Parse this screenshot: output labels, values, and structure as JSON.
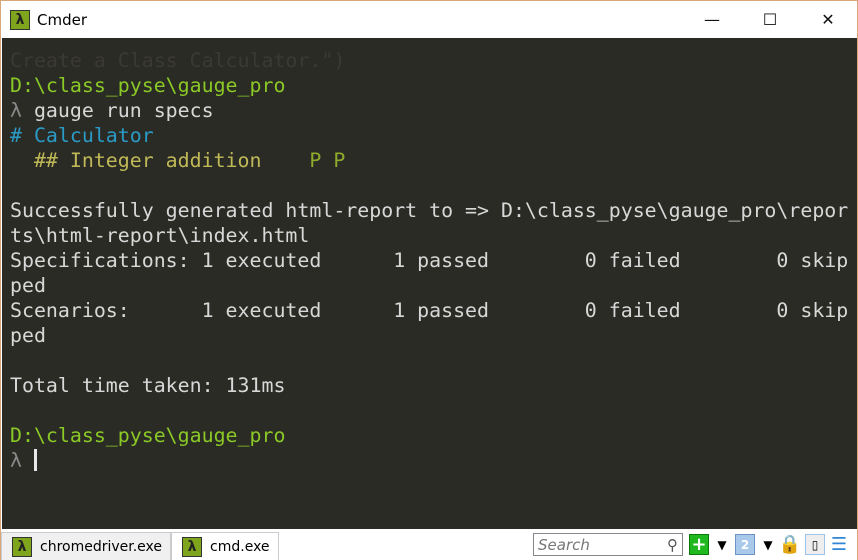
{
  "window": {
    "title": "Cmder",
    "minimize": "—",
    "maximize": "☐",
    "close": "✕"
  },
  "terminal": {
    "lines": [
      [
        {
          "t": "Create a Class Calculator.\")",
          "k": "f"
        }
      ],
      [
        {
          "t": "D:\\class_pyse\\gauge_pro",
          "k": "g"
        }
      ],
      [
        {
          "t": "λ ",
          "k": "l"
        },
        {
          "t": "gauge run specs",
          "k": ""
        }
      ],
      [
        {
          "t": "# Calculator",
          "k": "c"
        }
      ],
      [
        {
          "t": "  ## Integer addition    ",
          "k": "y"
        },
        {
          "t": "P P",
          "k": "p"
        }
      ],
      [
        {
          "t": "",
          "k": ""
        }
      ],
      [
        {
          "t": "Successfully generated html-report to => D:\\class_pyse\\gauge_pro\\repor",
          "k": ""
        }
      ],
      [
        {
          "t": "ts\\html-report\\index.html",
          "k": ""
        }
      ],
      [
        {
          "t": "Specifications: 1 executed      1 passed        0 failed        0 skip",
          "k": ""
        }
      ],
      [
        {
          "t": "ped",
          "k": ""
        }
      ],
      [
        {
          "t": "Scenarios:      1 executed      1 passed        0 failed        0 skip",
          "k": ""
        }
      ],
      [
        {
          "t": "ped",
          "k": ""
        }
      ],
      [
        {
          "t": "",
          "k": ""
        }
      ],
      [
        {
          "t": "Total time taken: 131ms",
          "k": ""
        }
      ],
      [
        {
          "t": "",
          "k": ""
        }
      ],
      [
        {
          "t": "D:\\class_pyse\\gauge_pro",
          "k": "g"
        }
      ],
      [
        {
          "t": "λ ",
          "k": "l"
        }
      ]
    ]
  },
  "tabs": [
    {
      "label": "chromedriver.exe"
    },
    {
      "label": "cmd.exe",
      "active": true
    }
  ],
  "toolbar": {
    "search_placeholder": "Search",
    "new_console": "+",
    "console_number": "2"
  },
  "colors": {
    "path": "#8ac926",
    "heading": "#2a9bc7",
    "scenario": "#c0b957",
    "background": "#2b2b25"
  }
}
